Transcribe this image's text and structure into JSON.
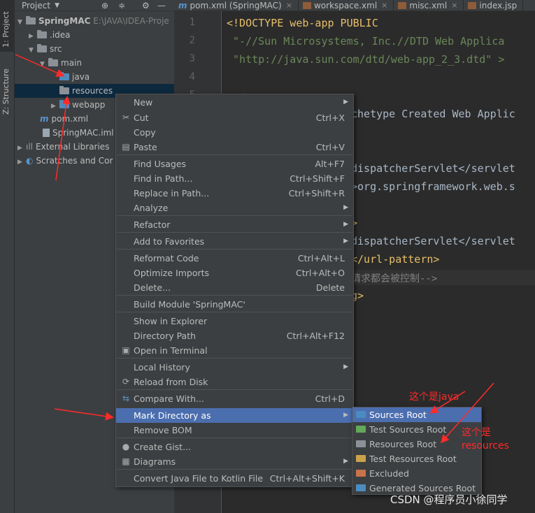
{
  "side_tabs": {
    "project": "1: Project",
    "structure": "Z: Structure"
  },
  "project_panel": {
    "header": "Project",
    "tree": [
      {
        "label": "SpringMAC",
        "extra": "E:\\JAVA\\IDEA-Proje"
      },
      {
        "label": ".idea"
      },
      {
        "label": "src"
      },
      {
        "label": "main"
      },
      {
        "label": "java"
      },
      {
        "label": "resources"
      },
      {
        "label": "webapp"
      },
      {
        "label": "pom.xml"
      },
      {
        "label": "SpringMAC.iml"
      },
      {
        "label": "External Libraries"
      },
      {
        "label": "Scratches and Cor"
      }
    ]
  },
  "editor_tabs": [
    "pom.xml (SpringMAC)",
    "workspace.xml",
    "misc.xml",
    "index.jsp"
  ],
  "line_numbers": [
    "1",
    "2",
    "3",
    "4",
    "5"
  ],
  "code_lines": [
    "<!DOCTYPE web-app PUBLIC",
    " \"-//Sun Microsystems, Inc.//DTD Web Applica",
    " \"http://java.sun.com/dtd/web-app_2_3.dtd\" >",
    "",
    "  <",
    "chetype Created Web Applic",
    "",
    "dispatcherServlet</servlet",
    ">org.springframework.web.s",
    "",
    ">",
    "dispatcherServlet</servlet",
    "</url-pattern>",
    "请求都会被控制-->",
    "g>"
  ],
  "context_menu": [
    {
      "label": "New",
      "shortcut": "",
      "submenu": true,
      "icon": ""
    },
    {
      "label": "Cut",
      "shortcut": "Ctrl+X",
      "icon": "scissors-icon"
    },
    {
      "label": "Copy",
      "shortcut": ""
    },
    {
      "label": "Paste",
      "shortcut": "Ctrl+V",
      "icon": "clipboard-icon"
    },
    {
      "label": "Find Usages",
      "shortcut": "Alt+F7"
    },
    {
      "label": "Find in Path...",
      "shortcut": "Ctrl+Shift+F"
    },
    {
      "label": "Replace in Path...",
      "shortcut": "Ctrl+Shift+R"
    },
    {
      "label": "Analyze",
      "shortcut": "",
      "submenu": true
    },
    {
      "label": "Refactor",
      "shortcut": "",
      "submenu": true
    },
    {
      "label": "Add to Favorites",
      "shortcut": "",
      "submenu": true
    },
    {
      "label": "Reformat Code",
      "shortcut": "Ctrl+Alt+L"
    },
    {
      "label": "Optimize Imports",
      "shortcut": "Ctrl+Alt+O"
    },
    {
      "label": "Delete...",
      "shortcut": "Delete"
    },
    {
      "label": "Build Module 'SpringMAC'",
      "shortcut": ""
    },
    {
      "label": "Show in Explorer",
      "shortcut": ""
    },
    {
      "label": "Directory Path",
      "shortcut": "Ctrl+Alt+F12"
    },
    {
      "label": "Open in Terminal",
      "shortcut": "",
      "icon": "terminal-icon"
    },
    {
      "label": "Local History",
      "shortcut": "",
      "submenu": true
    },
    {
      "label": "Reload from Disk",
      "shortcut": "",
      "icon": "reload-icon"
    },
    {
      "label": "Compare With...",
      "shortcut": "Ctrl+D",
      "icon": "compare-icon"
    },
    {
      "label": "Mark Directory as",
      "shortcut": "",
      "submenu": true,
      "active": true
    },
    {
      "label": "Remove BOM",
      "shortcut": ""
    },
    {
      "label": "Create Gist...",
      "shortcut": "",
      "icon": "github-icon"
    },
    {
      "label": "Diagrams",
      "shortcut": "",
      "submenu": true,
      "icon": "diagram-icon"
    },
    {
      "label": "Convert Java File to Kotlin File",
      "shortcut": "Ctrl+Alt+Shift+K"
    }
  ],
  "mark_submenu": [
    {
      "label": "Sources Root",
      "color": "#4c8bbf",
      "active": true
    },
    {
      "label": "Test Sources Root",
      "color": "#62a95a"
    },
    {
      "label": "Resources Root",
      "color": "#8b9197"
    },
    {
      "label": "Test Resources Root",
      "color": "#c9a24b"
    },
    {
      "label": "Excluded",
      "color": "#c8734a"
    },
    {
      "label": "Generated Sources Root",
      "color": "#4c8bbf"
    }
  ],
  "annotations": {
    "java_note": "这个是java",
    "resources_note_line1": "这个是",
    "resources_note_line2": "resources"
  },
  "watermark": "CSDN @程序员小徐同学",
  "colors": {
    "menu_highlight": "#4b6eaf",
    "annotation": "#ff2a2a"
  }
}
